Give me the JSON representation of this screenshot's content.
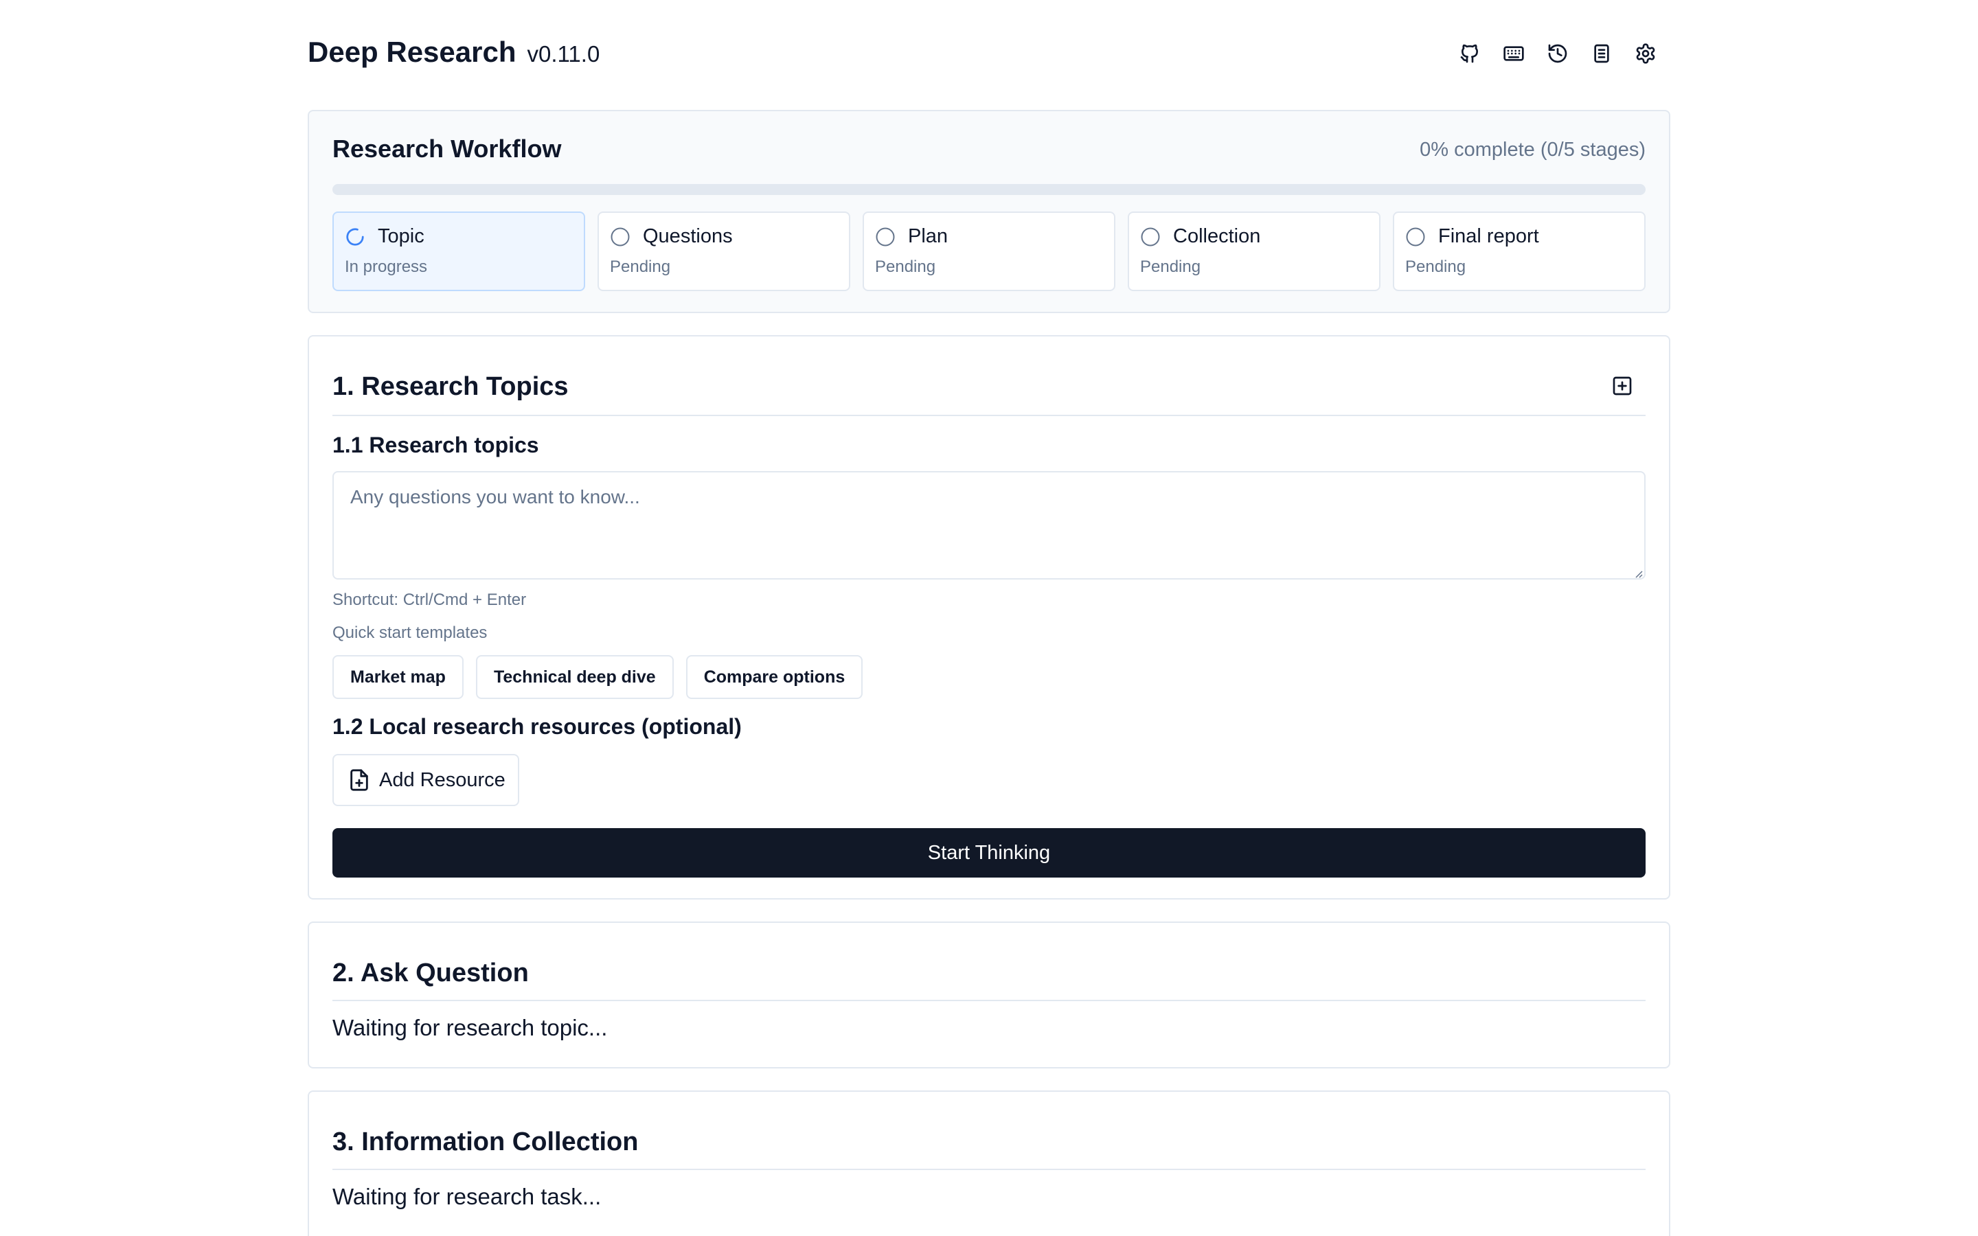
{
  "header": {
    "title": "Deep Research",
    "version": "v0.11.0",
    "icons": [
      "github-icon",
      "keyboard-icon",
      "history-icon",
      "knowledge-icon",
      "settings-icon"
    ]
  },
  "workflow": {
    "title": "Research Workflow",
    "progress_text": "0% complete (0/5 stages)",
    "progress": 0,
    "stages": [
      {
        "label": "Topic",
        "status": "In progress",
        "state": "active"
      },
      {
        "label": "Questions",
        "status": "Pending",
        "state": "pending"
      },
      {
        "label": "Plan",
        "status": "Pending",
        "state": "pending"
      },
      {
        "label": "Collection",
        "status": "Pending",
        "state": "pending"
      },
      {
        "label": "Final report",
        "status": "Pending",
        "state": "pending"
      }
    ]
  },
  "topics": {
    "title": "1. Research Topics",
    "sub1": "1.1 Research topics",
    "placeholder": "Any questions you want to know...",
    "value": "",
    "shortcut": "Shortcut: Ctrl/Cmd + Enter",
    "templates_label": "Quick start templates",
    "templates": [
      "Market map",
      "Technical deep dive",
      "Compare options"
    ],
    "sub2": "1.2 Local research resources (optional)",
    "add_resource": "Add Resource",
    "start": "Start Thinking"
  },
  "ask": {
    "title": "2. Ask Question",
    "waiting": "Waiting for research topic..."
  },
  "collection": {
    "title": "3. Information Collection",
    "waiting": "Waiting for research task..."
  },
  "colors": {
    "accent": "#3b82f6",
    "primary_button": "#111827",
    "muted_text": "#64748b",
    "border": "#e2e8f0"
  }
}
